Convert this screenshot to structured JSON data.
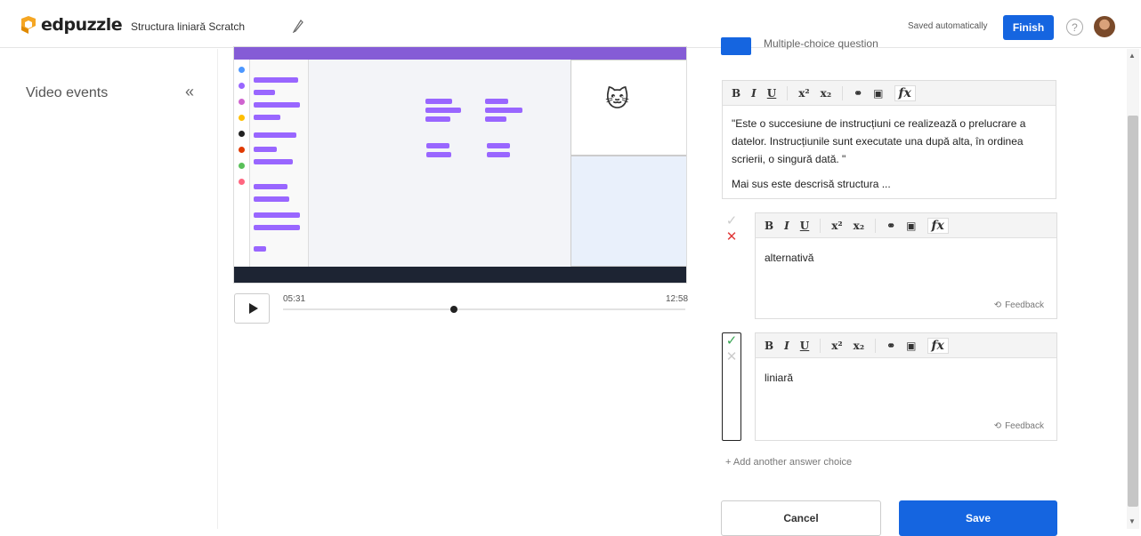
{
  "header": {
    "brand": "edpuzzle",
    "project_title": "Structura liniară Scratch",
    "saved_status": "Saved automatically",
    "finish_label": "Finish",
    "help_glyph": "?"
  },
  "sidebar": {
    "title": "Video events",
    "collapse_glyph": "«"
  },
  "player": {
    "current_time": "05:31",
    "total_time": "12:58",
    "progress_fraction": 0.425
  },
  "question": {
    "type_label": "Multiple-choice question",
    "toolbar": {
      "bold": "B",
      "italic": "I",
      "underline": "U",
      "superscript": "x²",
      "subscript": "x₂",
      "link": "⚭",
      "image": "▣",
      "formula": "fx"
    },
    "prompt_line1": "\"Este o succesiune de instrucțiuni ce realizează o prelucrare a",
    "prompt_line2": "datelor. Instrucțiunile sunt executate una după alta, în ordinea",
    "prompt_line3": "scrierii, o singură dată. \"",
    "prompt_line4": "Mai sus este descrisă structura ...",
    "answers": [
      {
        "text": "alternativă",
        "correct": false,
        "feedback_label": "Feedback"
      },
      {
        "text": "liniară",
        "correct": true,
        "feedback_label": "Feedback"
      }
    ],
    "add_choice_label": "+ Add another answer choice"
  },
  "actions": {
    "cancel_label": "Cancel",
    "save_label": "Save"
  },
  "colors": {
    "accent": "#1565e0",
    "correct": "#3aa655",
    "wrong": "#e03a3a"
  }
}
